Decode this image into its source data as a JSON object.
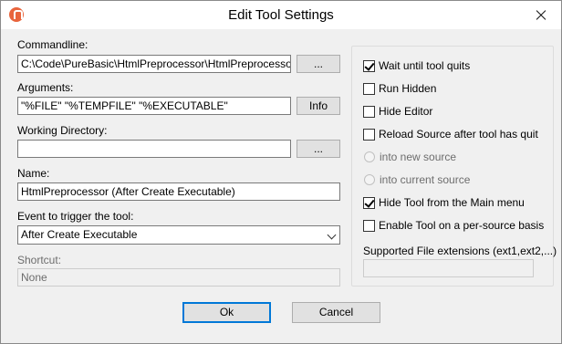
{
  "window": {
    "title": "Edit Tool Settings"
  },
  "commandline": {
    "label": "Commandline:",
    "value": "C:\\Code\\PureBasic\\HtmlPreprocessor\\HtmlPreprocessor.exe",
    "browse_label": "..."
  },
  "arguments": {
    "label": "Arguments:",
    "value": "\"%FILE\" \"%TEMPFILE\" \"%EXECUTABLE\"",
    "info_label": "Info"
  },
  "working_directory": {
    "label": "Working Directory:",
    "value": "",
    "browse_label": "..."
  },
  "name": {
    "label": "Name:",
    "value": "HtmlPreprocessor (After Create Executable)"
  },
  "event": {
    "label": "Event to trigger the tool:",
    "value": "After Create Executable"
  },
  "shortcut": {
    "label": "Shortcut:",
    "value": "None"
  },
  "options": {
    "wait_until_quits": {
      "label": "Wait until tool quits",
      "checked": true
    },
    "run_hidden": {
      "label": "Run Hidden",
      "checked": false
    },
    "hide_editor": {
      "label": "Hide Editor",
      "checked": false
    },
    "reload_source": {
      "label": "Reload Source after tool has quit",
      "checked": false
    },
    "into_new_source": {
      "label": "into new source",
      "selected": true
    },
    "into_current_source": {
      "label": "into current source",
      "selected": false
    },
    "hide_from_menu": {
      "label": "Hide Tool from the Main menu",
      "checked": true
    },
    "per_source": {
      "label": "Enable Tool on a per-source basis",
      "checked": false
    }
  },
  "extensions": {
    "label": "Supported File extensions (ext1,ext2,...)",
    "value": ""
  },
  "buttons": {
    "ok": "Ok",
    "cancel": "Cancel"
  }
}
